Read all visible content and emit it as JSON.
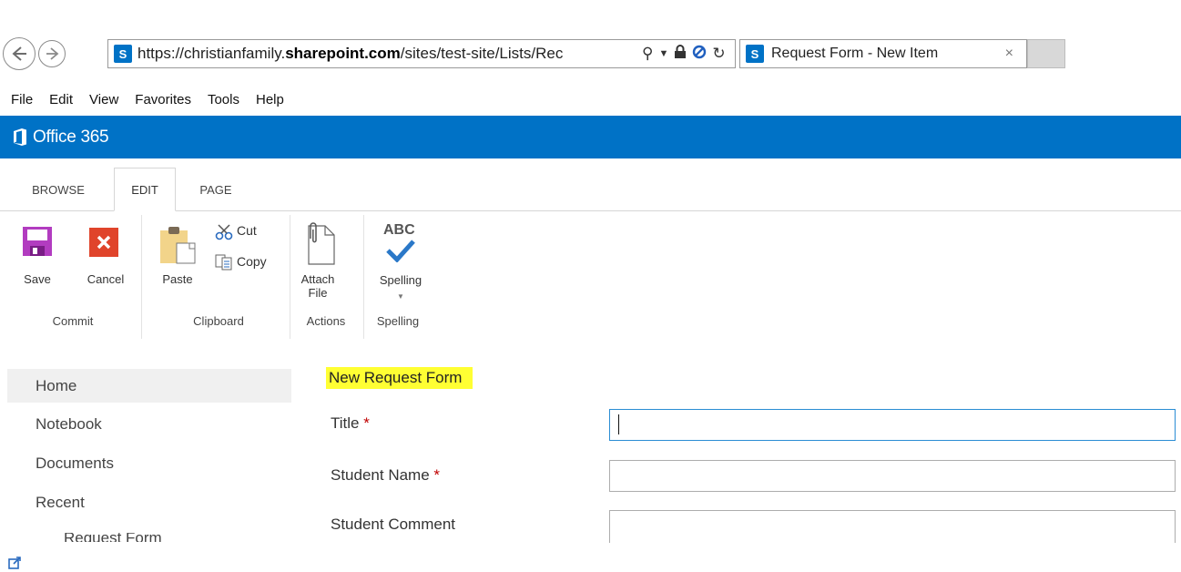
{
  "browser": {
    "url_prefix": "https://christianfamily.",
    "url_domain": "sharepoint.com",
    "url_rest": "/sites/test-site/Lists/Rec",
    "site_badge": "S",
    "tab_title": "Request Form - New Item",
    "tab_close": "×",
    "menu": [
      "File",
      "Edit",
      "View",
      "Favorites",
      "Tools",
      "Help"
    ]
  },
  "suite_bar": {
    "title": "Office 365",
    "color": "#0072c6"
  },
  "ribbon": {
    "tabs": [
      "BROWSE",
      "EDIT",
      "PAGE"
    ],
    "active_tab": "EDIT",
    "buttons": {
      "save": "Save",
      "cancel": "Cancel",
      "paste": "Paste",
      "cut": "Cut",
      "copy": "Copy",
      "attach_line1": "Attach",
      "attach_line2": "File",
      "spelling_icon_text": "ABC",
      "spelling": "Spelling"
    },
    "groups": [
      "Commit",
      "Clipboard",
      "Actions",
      "Spelling"
    ]
  },
  "left_nav": {
    "items": [
      "Home",
      "Notebook",
      "Documents",
      "Recent"
    ],
    "selected": "Home",
    "sub_item": "Request Form"
  },
  "form": {
    "heading": "New Request Form",
    "fields": [
      {
        "label": "Title",
        "required": "*",
        "value": ""
      },
      {
        "label": "Student Name",
        "required": "*",
        "value": ""
      },
      {
        "label": "Student Comment",
        "required": "",
        "value": ""
      }
    ]
  },
  "colors": {
    "accent": "#0072c6",
    "save": "#b23cc0",
    "cancel": "#e0442b",
    "highlight": "#ffff33",
    "required": "#c00000"
  }
}
